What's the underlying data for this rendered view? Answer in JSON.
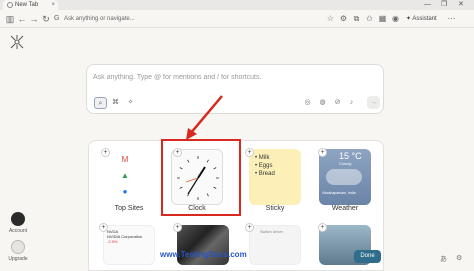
{
  "browser": {
    "tab_title": "New Tab",
    "tab_close": "×",
    "window_controls": [
      "—",
      "❐",
      "✕"
    ],
    "address_placeholder": "Ask anything or navigate...",
    "assistant_label": "Assistant"
  },
  "rail": {
    "account_label": "Account",
    "upgrade_label": "Upgrade"
  },
  "search": {
    "placeholder": "Ask anything. Type @ for mentions and / for shortcuts.",
    "send_icon": "→"
  },
  "widgets": {
    "top_sites_label": "Top Sites",
    "clock_label": "Clock",
    "sticky_label": "Sticky",
    "weather_label": "Weather",
    "sticky_items": [
      "Milk",
      "Eggs",
      "Bread"
    ],
    "weather_temp": "15 °C",
    "weather_condition": "Cloudy",
    "weather_location": "Visakhapatnam, India",
    "stock_ticker": "NVDA",
    "stock_company": "NVIDIA Corporation",
    "stock_change": "-2.5%",
    "social_text": "Switch driver"
  },
  "watermark": "www.TestingDocs.com",
  "done_label": "Done",
  "colors": {
    "highlight": "#d9291e",
    "done_button": "#2f6d8a",
    "sticky": "#fcefb8"
  }
}
